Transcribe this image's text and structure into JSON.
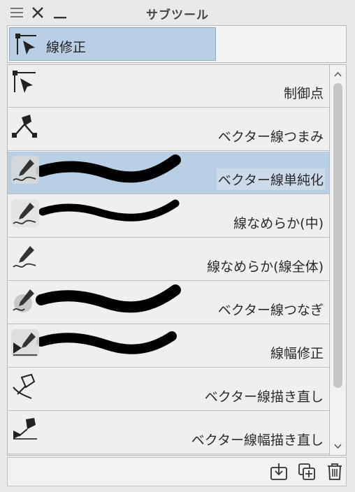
{
  "window": {
    "title": "サブツール",
    "icons": [
      "menu-icon",
      "close-icon",
      "minimize-icon"
    ]
  },
  "group": {
    "label": "線修正",
    "icon": "correct-line-icon"
  },
  "tools": [
    {
      "label": "制御点",
      "icon": "control-point-icon",
      "selected": false
    },
    {
      "label": "ベクター線つまみ",
      "icon": "pinch-vector-line-icon",
      "selected": false
    },
    {
      "label": "ベクター線単純化",
      "icon": "simplify-vector-line-icon",
      "selected": true
    },
    {
      "label": "線なめらか(中)",
      "icon": "smooth-line-icon",
      "selected": false
    },
    {
      "label": "線なめらか(線全体)",
      "icon": "smooth-line-icon",
      "selected": false
    },
    {
      "label": "ベクター線つなぎ",
      "icon": "connect-vector-line-icon",
      "selected": false
    },
    {
      "label": "線幅修正",
      "icon": "redraw-line-width-icon",
      "selected": false
    },
    {
      "label": "ベクター線描き直し",
      "icon": "redraw-vector-line-icon",
      "selected": false
    },
    {
      "label": "ベクター線幅描き直し",
      "icon": "redraw-vector-line-width-icon",
      "selected": false
    }
  ],
  "footer": {
    "icons": [
      "import-icon",
      "duplicate-icon",
      "delete-icon"
    ]
  },
  "colors": {
    "selected": "#b8cfe6",
    "background": "#e9e9e9"
  }
}
